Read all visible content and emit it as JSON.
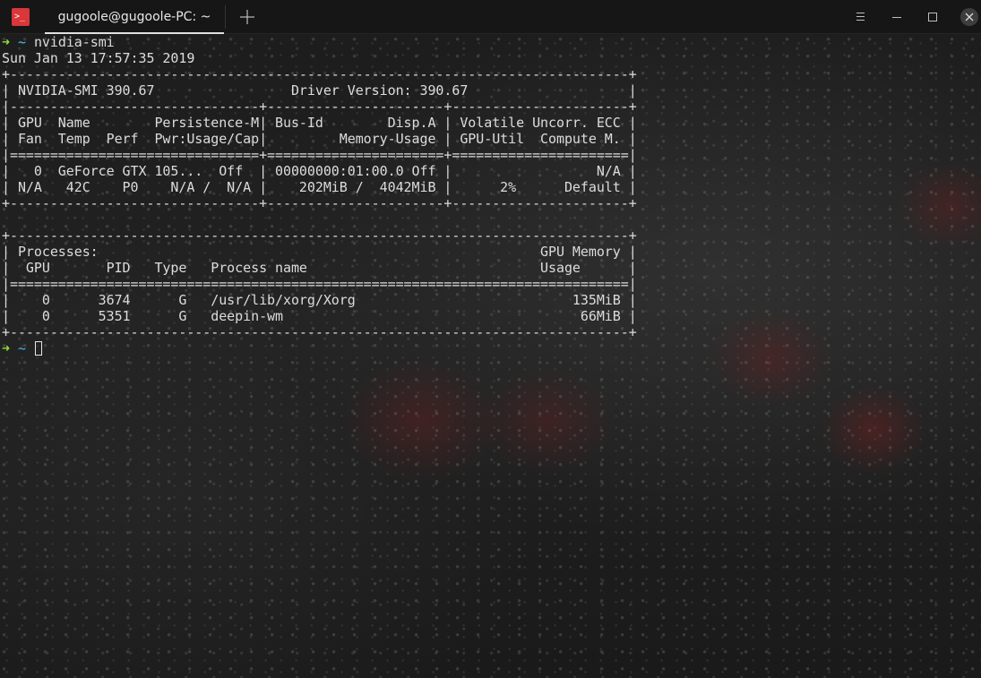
{
  "window": {
    "tab_title": "gugoole@gugoole-PC: ~",
    "add_tab_icon": "plus-icon",
    "buttons": [
      "menu-icon",
      "minimize-icon",
      "maximize-icon",
      "close-icon"
    ],
    "app_icon_glyph": ">_"
  },
  "colors": {
    "prompt_arrow": "#8ae234",
    "prompt_dir": "#3ec2e8",
    "text": "#dcdcdc",
    "app_icon": "#d9373a"
  },
  "terminal": {
    "prompt_arrow": "➜",
    "prompt_dir": "~",
    "command": "nvidia-smi",
    "lines": [
      "Sun Jan 13 17:57:35 2019",
      "+-----------------------------------------------------------------------------+",
      "| NVIDIA-SMI 390.67                 Driver Version: 390.67                    |",
      "|-------------------------------+----------------------+----------------------+",
      "| GPU  Name        Persistence-M| Bus-Id        Disp.A | Volatile Uncorr. ECC |",
      "| Fan  Temp  Perf  Pwr:Usage/Cap|         Memory-Usage | GPU-Util  Compute M. |",
      "|===============================+======================+======================|",
      "|   0  GeForce GTX 105...  Off  | 00000000:01:00.0 Off |                  N/A |",
      "| N/A   42C    P0    N/A /  N/A |    202MiB /  4042MiB |      2%      Default |",
      "+-------------------------------+----------------------+----------------------+",
      "",
      "+-----------------------------------------------------------------------------+",
      "| Processes:                                                       GPU Memory |",
      "|  GPU       PID   Type   Process name                             Usage      |",
      "|=============================================================================|",
      "|    0      3674      G   /usr/lib/xorg/Xorg                           135MiB |",
      "|    0      5351      G   deepin-wm                                     66MiB |",
      "+-----------------------------------------------------------------------------+"
    ]
  }
}
